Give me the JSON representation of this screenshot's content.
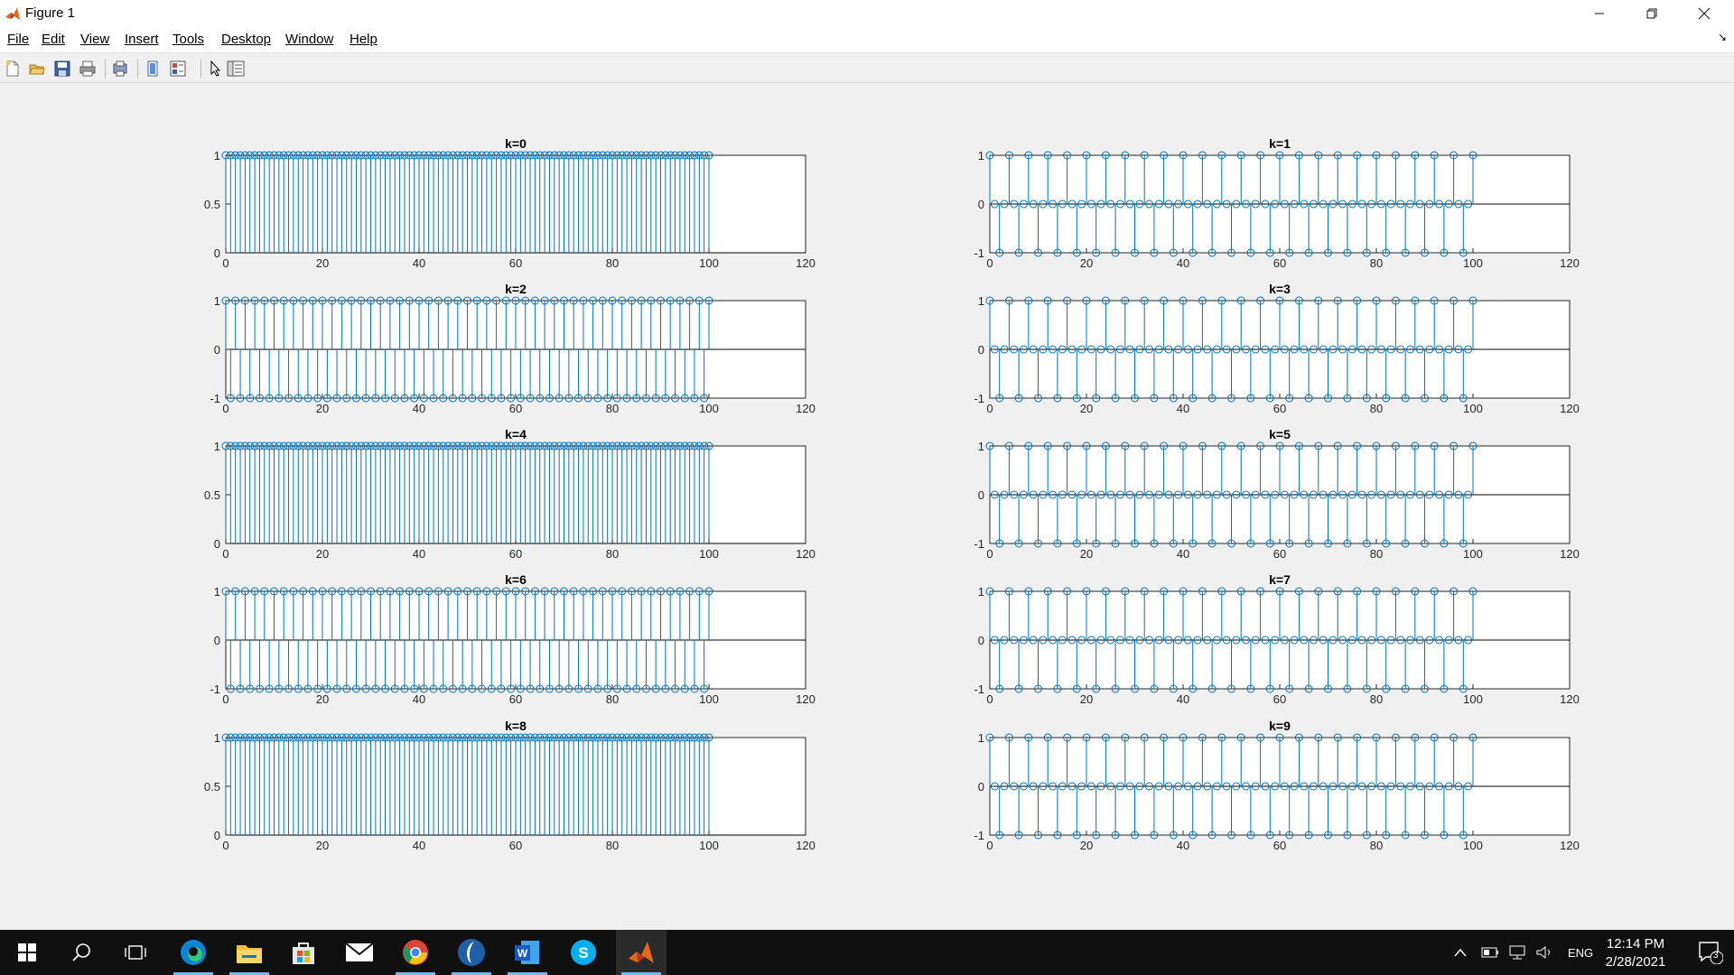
{
  "window": {
    "title": "Figure 1"
  },
  "menu": [
    "File",
    "Edit",
    "View",
    "Insert",
    "Tools",
    "Desktop",
    "Window",
    "Help"
  ],
  "toolbar": [
    "new-figure",
    "open-file",
    "save",
    "print",
    "print-preview",
    "hide-plot-tools",
    "show-plot-tools",
    "edit-plot",
    "open-property-inspector"
  ],
  "colors": {
    "stem": "#0072bd",
    "axes": "#262626",
    "background": "#f0f0f0"
  },
  "x_ticks": [
    "0",
    "20",
    "40",
    "60",
    "80",
    "100",
    "120"
  ],
  "chart_data": [
    {
      "type": "stem",
      "title": "k=0",
      "xlim": [
        0,
        120
      ],
      "ylim": [
        0,
        1
      ],
      "yticks": [
        "0",
        "0.5",
        "1"
      ],
      "n_range": [
        0,
        100
      ],
      "formula": "cos(2*pi*k*n/4)",
      "k": 0
    },
    {
      "type": "stem",
      "title": "k=1",
      "xlim": [
        0,
        120
      ],
      "ylim": [
        -1,
        1
      ],
      "yticks": [
        "-1",
        "0",
        "1"
      ],
      "n_range": [
        0,
        100
      ],
      "formula": "cos(2*pi*k*n/4)",
      "k": 1
    },
    {
      "type": "stem",
      "title": "k=2",
      "xlim": [
        0,
        120
      ],
      "ylim": [
        -1,
        1
      ],
      "yticks": [
        "-1",
        "0",
        "1"
      ],
      "n_range": [
        0,
        100
      ],
      "formula": "cos(2*pi*k*n/4)",
      "k": 2
    },
    {
      "type": "stem",
      "title": "k=3",
      "xlim": [
        0,
        120
      ],
      "ylim": [
        -1,
        1
      ],
      "yticks": [
        "-1",
        "0",
        "1"
      ],
      "n_range": [
        0,
        100
      ],
      "formula": "cos(2*pi*k*n/4)",
      "k": 3
    },
    {
      "type": "stem",
      "title": "k=4",
      "xlim": [
        0,
        120
      ],
      "ylim": [
        0,
        1
      ],
      "yticks": [
        "0",
        "0.5",
        "1"
      ],
      "n_range": [
        0,
        100
      ],
      "formula": "cos(2*pi*k*n/4)",
      "k": 4
    },
    {
      "type": "stem",
      "title": "k=5",
      "xlim": [
        0,
        120
      ],
      "ylim": [
        -1,
        1
      ],
      "yticks": [
        "-1",
        "0",
        "1"
      ],
      "n_range": [
        0,
        100
      ],
      "formula": "cos(2*pi*k*n/4)",
      "k": 5
    },
    {
      "type": "stem",
      "title": "k=6",
      "xlim": [
        0,
        120
      ],
      "ylim": [
        -1,
        1
      ],
      "yticks": [
        "-1",
        "0",
        "1"
      ],
      "n_range": [
        0,
        100
      ],
      "formula": "cos(2*pi*k*n/4)",
      "k": 6
    },
    {
      "type": "stem",
      "title": "k=7",
      "xlim": [
        0,
        120
      ],
      "ylim": [
        -1,
        1
      ],
      "yticks": [
        "-1",
        "0",
        "1"
      ],
      "n_range": [
        0,
        100
      ],
      "formula": "cos(2*pi*k*n/4)",
      "k": 7
    },
    {
      "type": "stem",
      "title": "k=8",
      "xlim": [
        0,
        120
      ],
      "ylim": [
        0,
        1
      ],
      "yticks": [
        "0",
        "0.5",
        "1"
      ],
      "n_range": [
        0,
        100
      ],
      "formula": "cos(2*pi*k*n/4)",
      "k": 8
    },
    {
      "type": "stem",
      "title": "k=9",
      "xlim": [
        0,
        120
      ],
      "ylim": [
        -1,
        1
      ],
      "yticks": [
        "-1",
        "0",
        "1"
      ],
      "n_range": [
        0,
        100
      ],
      "formula": "cos(2*pi*k*n/4)",
      "k": 9
    }
  ],
  "taskbar": {
    "apps": [
      "windows-start",
      "search",
      "task-view",
      "edge",
      "file-explorer",
      "store",
      "mail",
      "chrome",
      "app-blue-circle",
      "word",
      "skype",
      "matlab"
    ],
    "language": "ENG",
    "time": "12:14 PM",
    "date": "2/28/2021",
    "notification_count": "3"
  }
}
